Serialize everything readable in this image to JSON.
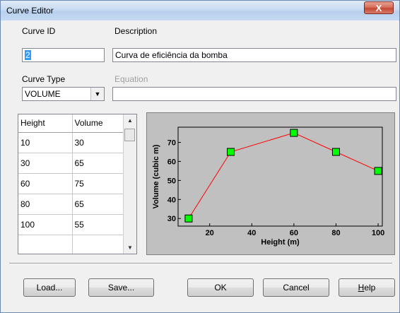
{
  "window": {
    "title": "Curve Editor",
    "close_label": "X"
  },
  "form": {
    "curve_id_label": "Curve ID",
    "curve_id_value": "2",
    "description_label": "Description",
    "description_value": "Curva de eficiência da bomba",
    "curve_type_label": "Curve Type",
    "curve_type_value": "VOLUME",
    "equation_label": "Equation",
    "equation_value": ""
  },
  "table": {
    "headers": [
      "Height",
      "Volume"
    ],
    "rows": [
      [
        "10",
        "30"
      ],
      [
        "30",
        "65"
      ],
      [
        "60",
        "75"
      ],
      [
        "80",
        "65"
      ],
      [
        "100",
        "55"
      ],
      [
        "",
        ""
      ]
    ]
  },
  "chart_data": {
    "type": "line",
    "x": [
      10,
      30,
      60,
      80,
      100
    ],
    "y": [
      30,
      65,
      75,
      65,
      55
    ],
    "xlabel": "Height (m)",
    "ylabel": "Volume (cubic m)",
    "xlim": [
      10,
      100
    ],
    "ylim": [
      30,
      75
    ],
    "xticks": [
      20,
      40,
      60,
      80,
      100
    ],
    "yticks": [
      30,
      40,
      50,
      60,
      70
    ],
    "grid": false,
    "colors": {
      "line": "#ff0000",
      "marker": "#00ff00",
      "plot_bg": "#c0c0c0"
    }
  },
  "buttons": {
    "load": "Load...",
    "save": "Save...",
    "ok": "OK",
    "cancel": "Cancel",
    "help": "Help"
  }
}
